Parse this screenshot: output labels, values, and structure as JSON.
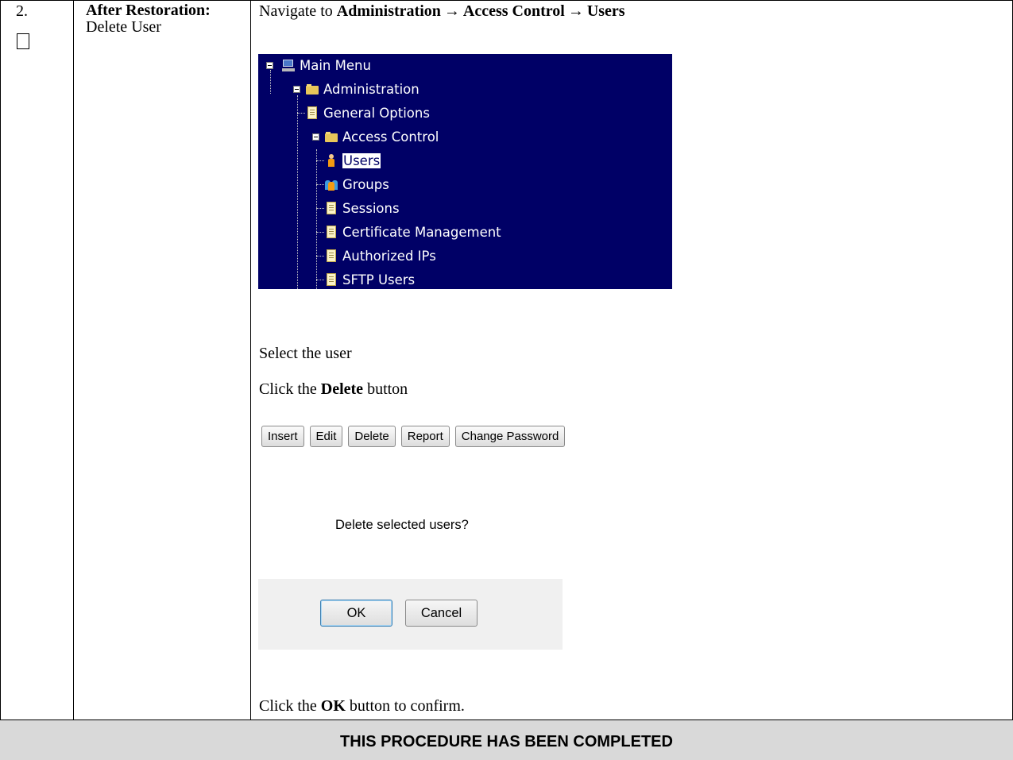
{
  "step": {
    "number": "2.",
    "title_bold": "After Restoration:",
    "title_normal": "Delete User"
  },
  "navigation": {
    "prefix": "Navigate to",
    "path": [
      "Administration",
      "Access Control",
      "Users"
    ],
    "arrow": "→"
  },
  "tree_menu": {
    "items": [
      {
        "label": "Main Menu",
        "icon": "computer-icon"
      },
      {
        "label": "Administration",
        "icon": "folder-icon"
      },
      {
        "label": "General Options",
        "icon": "document-icon"
      },
      {
        "label": "Access Control",
        "icon": "folder-icon"
      },
      {
        "label": "Users",
        "icon": "user-icon",
        "selected": true
      },
      {
        "label": "Groups",
        "icon": "group-icon"
      },
      {
        "label": "Sessions",
        "icon": "document-icon"
      },
      {
        "label": "Certificate Management",
        "icon": "document-icon"
      },
      {
        "label": "Authorized IPs",
        "icon": "document-icon"
      },
      {
        "label": "SFTP Users",
        "icon": "document-icon"
      }
    ],
    "background": "#000066"
  },
  "instructions": {
    "select_user": "Select the user",
    "click_prefix": "Click the",
    "delete_word": "Delete",
    "click_suffix": "button",
    "ok_prefix": "Click the",
    "ok_word": "OK",
    "ok_suffix": "button to confirm."
  },
  "button_bar": {
    "buttons": [
      "Insert",
      "Edit",
      "Delete",
      "Report",
      "Change Password"
    ]
  },
  "dialog": {
    "message": "Delete selected users?",
    "ok_label": "OK",
    "cancel_label": "Cancel"
  },
  "footer": {
    "text": "THIS PROCEDURE HAS BEEN COMPLETED"
  }
}
